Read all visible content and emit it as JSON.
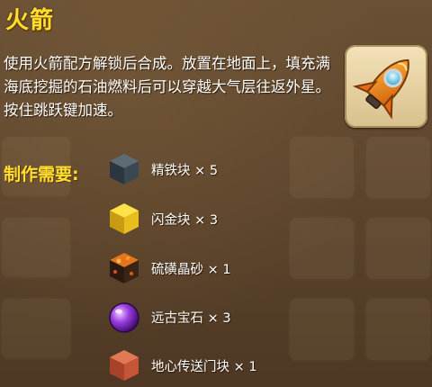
{
  "item": {
    "title": "火箭",
    "description": "使用火箭配方解锁后合成。放置在地面上，填充满海底挖掘的石油燃料后可以穿越大气层往返外星。按住跳跃键加速。",
    "icon": "rocket-icon"
  },
  "recipe": {
    "label": "制作需要:",
    "materials": [
      {
        "name": "精铁块 × 5",
        "icon": "refined-iron-block-icon",
        "color": "#3a4650"
      },
      {
        "name": "闪金块 × 3",
        "icon": "gold-block-icon",
        "color": "#e2b91f"
      },
      {
        "name": "硫磺晶砂 × 1",
        "icon": "sulfur-crystal-sand-icon",
        "color": "#c8581c"
      },
      {
        "name": "远古宝石 × 3",
        "icon": "ancient-gem-icon",
        "color": "#8a2fd1"
      },
      {
        "name": "地心传送门块 × 1",
        "icon": "earth-core-portal-block-icon",
        "color": "#c95a3c"
      }
    ]
  }
}
